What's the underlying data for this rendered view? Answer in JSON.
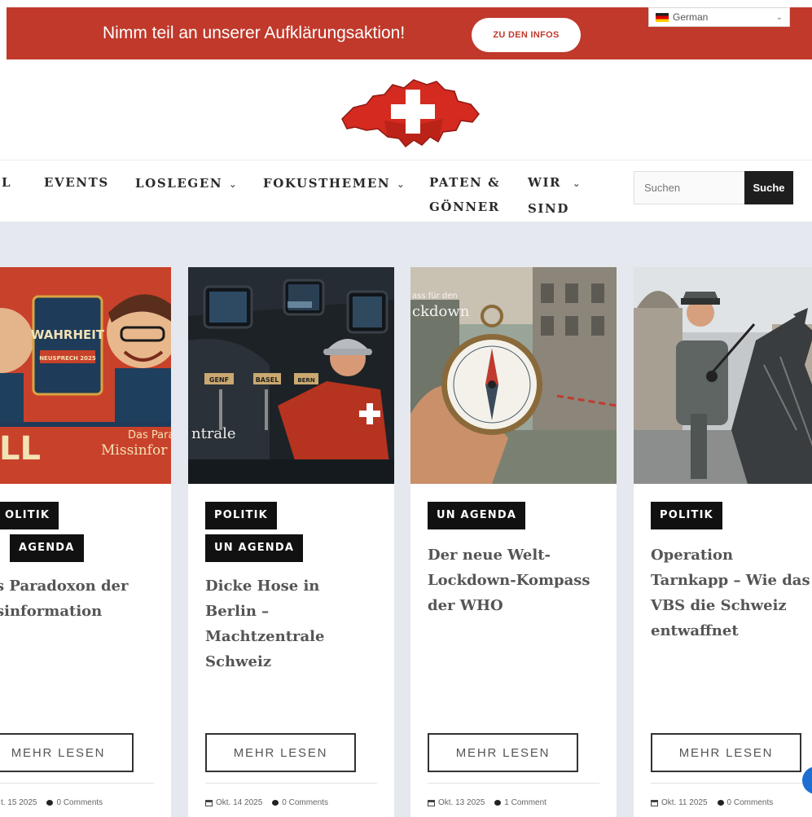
{
  "topbar": {
    "text": "Nimm teil an unserer Aufklärungsaktion!",
    "button_label": "ZU DEN INFOS",
    "language": "German",
    "accent_color": "#c0392b"
  },
  "logo": {
    "icon": "swiss-map-logo"
  },
  "nav": {
    "items": [
      {
        "label": "L",
        "has_dropdown": false
      },
      {
        "label": "EVENTS",
        "has_dropdown": false
      },
      {
        "label": "LOSLEGEN",
        "has_dropdown": true
      },
      {
        "label": "FOKUSTHEMEN",
        "has_dropdown": true
      },
      {
        "label_line1": "PATEN &",
        "label_line2": "GÖNNER",
        "has_dropdown": false
      },
      {
        "label_line1": "WIR",
        "label_line2": "SIND",
        "has_dropdown": true
      }
    ],
    "search_placeholder": "Suchen",
    "search_button": "Suche"
  },
  "cards": [
    {
      "image_text_top": "WAHRHEIT",
      "image_text_sub": "NEUSPRECH 2025",
      "image_text_left": "LL",
      "image_caption_line1": "Das Para",
      "image_caption_line2": "Missinfor",
      "tags": [
        "OLITIK",
        "AGENDA"
      ],
      "title": "s Paradoxon der sinformation",
      "button": "MEHR LESEN",
      "date": "t. 15 2025",
      "comments": "0 Comments"
    },
    {
      "image_labels": [
        "GENF",
        "BASEL",
        "BERN"
      ],
      "image_caption": "ntrale",
      "tags": [
        "POLITIK",
        "UN AGENDA"
      ],
      "title": "Dicke Hose in Berlin – Machtzentrale Schweiz",
      "button": "MEHR LESEN",
      "date": "Okt. 14 2025",
      "comments": "0 Comments"
    },
    {
      "image_caption_line1": "ass für den",
      "image_caption_line2": "ckdown",
      "tags": [
        "UN AGENDA"
      ],
      "title": "Der neue Welt-Lockdown-Kompass der WHO",
      "button": "MEHR LESEN",
      "date": "Okt. 13 2025",
      "comments": "1 Comment"
    },
    {
      "tags": [
        "POLITIK"
      ],
      "title": "Operation Tarnkapp – Wie das VBS die Schweiz entwaffnet",
      "button": "MEHR LESEN",
      "date": "Okt. 11 2025",
      "comments": "0 Comments"
    }
  ]
}
